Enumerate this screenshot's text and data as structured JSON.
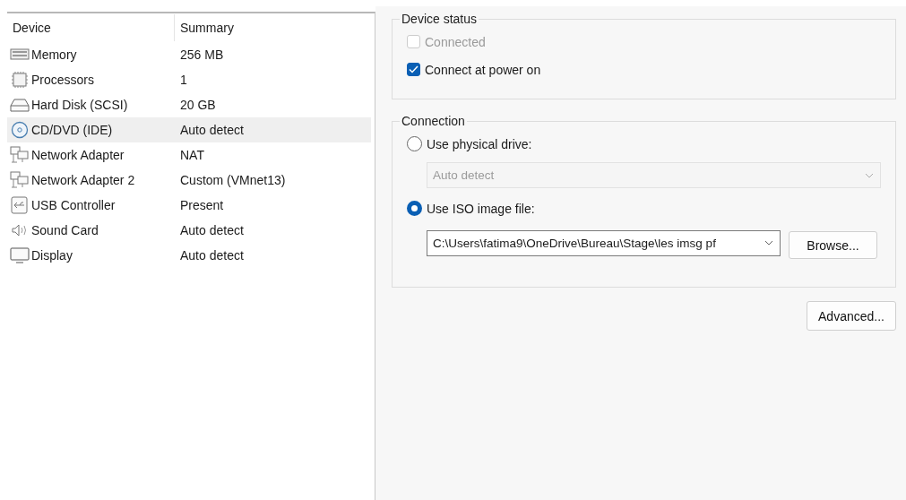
{
  "device_list": {
    "columns": [
      "Device",
      "Summary"
    ],
    "rows": [
      {
        "kind": "memory",
        "device": "Memory",
        "summary": "256 MB",
        "selected": false
      },
      {
        "kind": "processor",
        "device": "Processors",
        "summary": "1",
        "selected": false
      },
      {
        "kind": "disk",
        "device": "Hard Disk (SCSI)",
        "summary": "20 GB",
        "selected": false
      },
      {
        "kind": "cdrom",
        "device": "CD/DVD (IDE)",
        "summary": "Auto detect",
        "selected": true
      },
      {
        "kind": "network",
        "device": "Network Adapter",
        "summary": "NAT",
        "selected": false
      },
      {
        "kind": "network",
        "device": "Network Adapter 2",
        "summary": "Custom (VMnet13)",
        "selected": false
      },
      {
        "kind": "usb",
        "device": "USB Controller",
        "summary": "Present",
        "selected": false
      },
      {
        "kind": "sound",
        "device": "Sound Card",
        "summary": "Auto detect",
        "selected": false
      },
      {
        "kind": "display",
        "device": "Display",
        "summary": "Auto detect",
        "selected": false
      }
    ]
  },
  "device_status": {
    "title": "Device status",
    "checkboxes": [
      {
        "label": "Connected",
        "checked": false,
        "disabled": true
      },
      {
        "label": "Connect at power on",
        "checked": true,
        "disabled": false
      }
    ]
  },
  "connection": {
    "title": "Connection",
    "options": [
      {
        "label": "Use physical drive:",
        "selected": false,
        "field": {
          "value": "Auto detect",
          "disabled": true
        }
      },
      {
        "label": "Use ISO image file:",
        "selected": true,
        "field": {
          "value": "C:\\Users\\fatima9\\OneDrive\\Bureau\\Stage\\les imsg pf",
          "disabled": false
        },
        "button": "Browse..."
      }
    ]
  },
  "advanced_button": "Advanced..."
}
